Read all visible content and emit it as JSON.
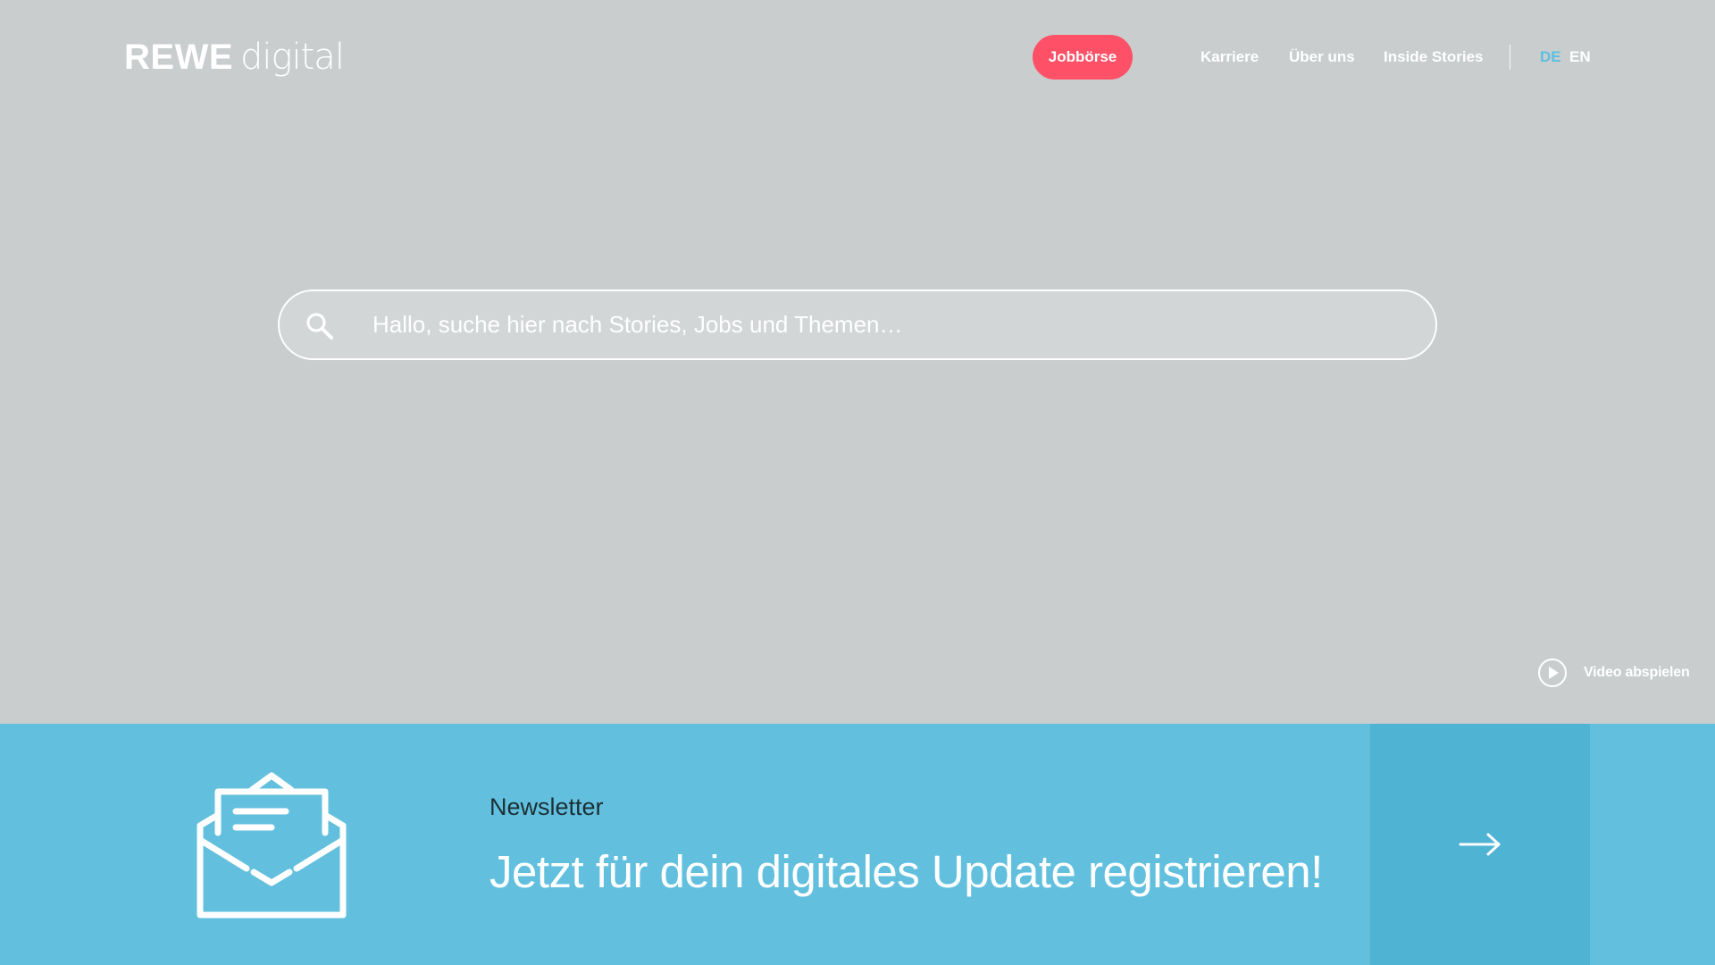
{
  "header": {
    "logo_brand": "REWE",
    "logo_sub": "digital",
    "job_button_label": "Jobbörse",
    "nav": {
      "karriere": "Karriere",
      "ueber_uns": "Über uns",
      "inside_stories": "Inside Stories"
    },
    "languages": {
      "de": "DE",
      "en": "EN"
    }
  },
  "search": {
    "placeholder": "Hallo, suche hier nach Stories, Jobs und Themen…",
    "value": "",
    "icon": "search-icon"
  },
  "video": {
    "label": "Video abspielen",
    "icon": "play-circle-icon"
  },
  "newsletter": {
    "kicker": "Newsletter",
    "headline": "Jetzt für dein digitales Update registrieren!",
    "icon": "open-envelope-icon",
    "cta_icon": "arrow-right-icon"
  },
  "colors": {
    "background": "#c9cdce",
    "job_button": "#fe5066",
    "active_language": "#5bbfe0",
    "newsletter_bg": "#62c0de",
    "newsletter_cta_bg": "#4fb3d4"
  }
}
